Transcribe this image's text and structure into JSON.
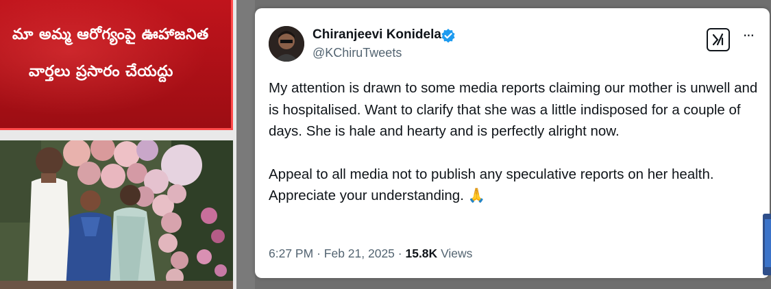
{
  "news": {
    "headline_line1": "మా అమ్మ ఆరోగ్యంపై ఊహాజనిత",
    "headline_line2": "వార్తలు ప్రసారం చేయద్దు"
  },
  "tweet": {
    "name": "Chiranjeevi Konidela",
    "handle": "@KChiruTweets",
    "grok_label": "X",
    "more_label": "···",
    "paragraph1": "My attention is drawn to some media reports claiming our mother is unwell and is hospitalised. Want to clarify that she was a little indisposed for a couple of days. She is hale and hearty and is perfectly alright now.",
    "paragraph2": "Appeal to all media not to publish any speculative reports on her health. Appreciate your understanding.",
    "emoji": "🙏",
    "time": "6:27 PM",
    "date": "Feb 21, 2025",
    "separator": "·",
    "views_count": "15.8K",
    "views_label": "Views"
  },
  "colors": {
    "headline_red": "#b5121a",
    "verified_blue": "#1d9bf0",
    "text_primary": "#0f1419",
    "text_secondary": "#536471"
  },
  "icons": {
    "verified": "verified-badge-icon",
    "grok": "grok-icon",
    "more": "more-options-icon"
  }
}
